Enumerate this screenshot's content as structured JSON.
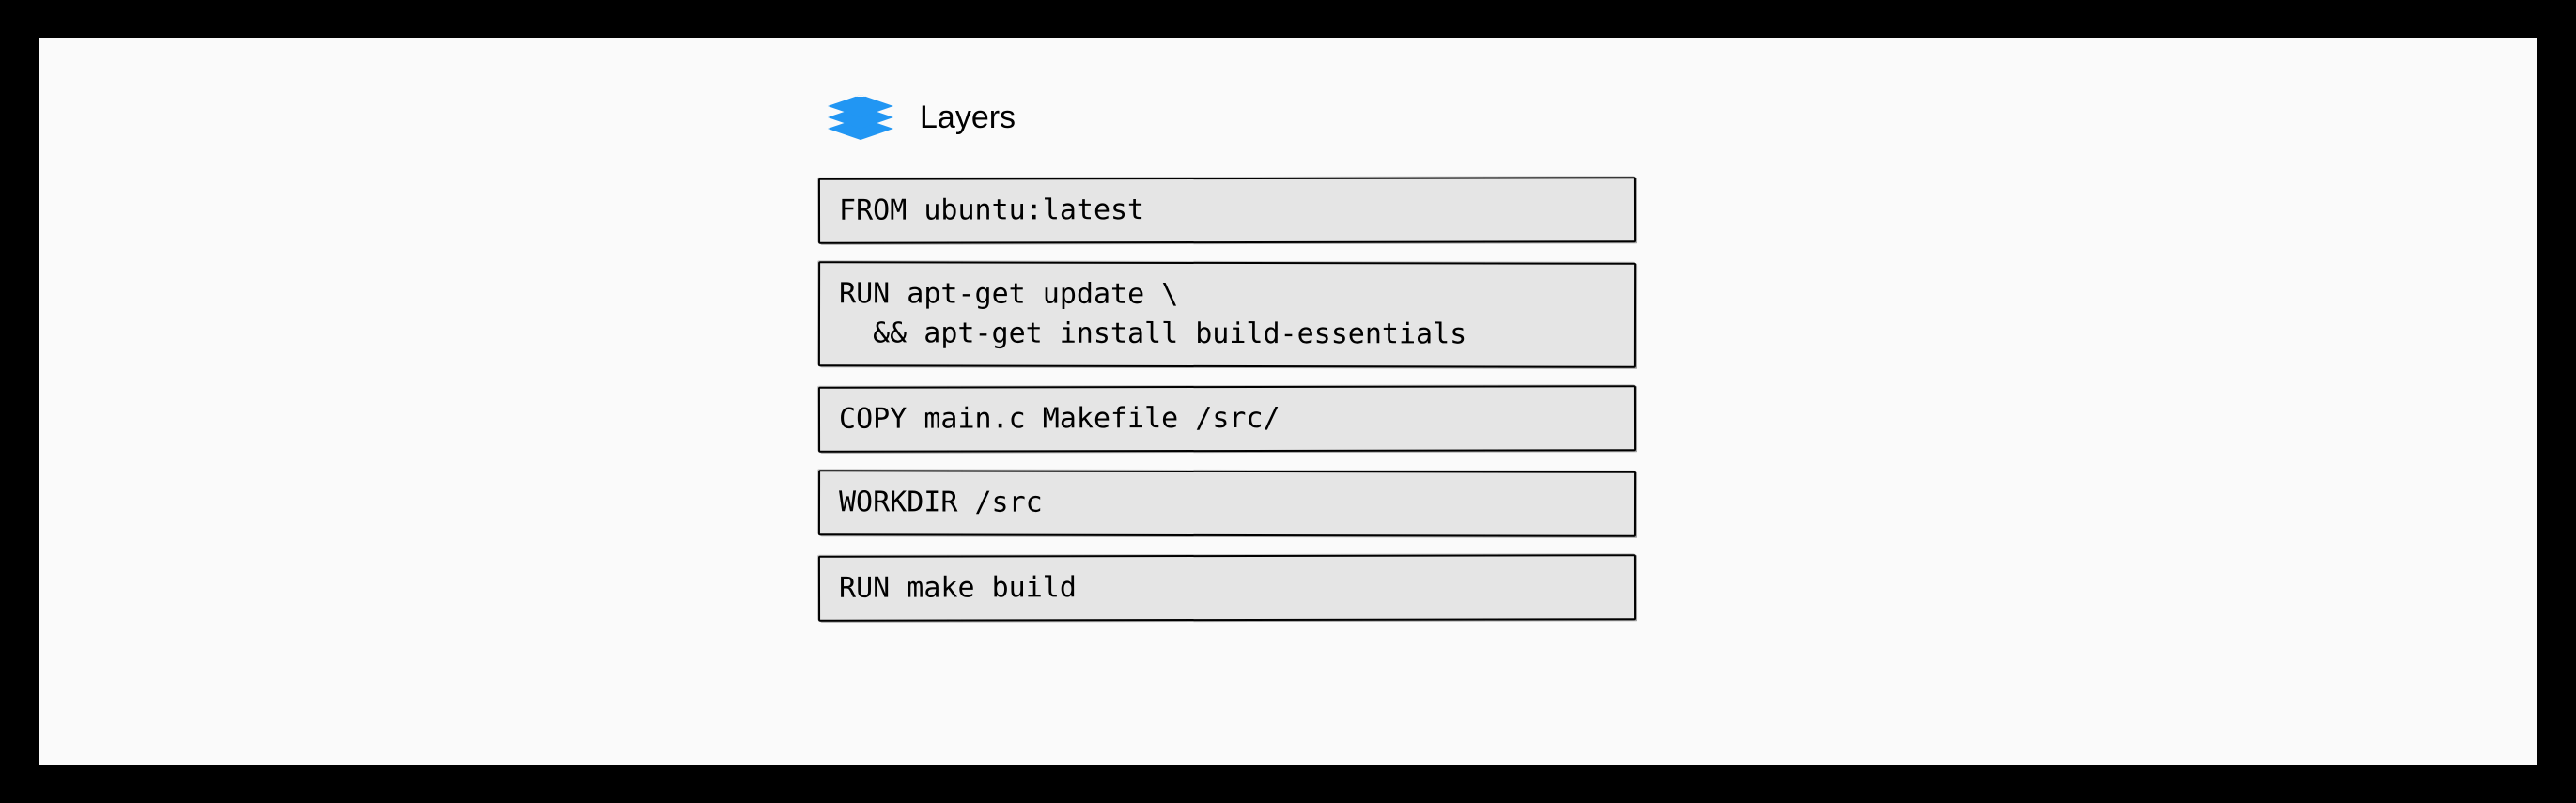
{
  "title": "Layers",
  "icon": "layers-icon",
  "instructions": [
    "FROM ubuntu:latest",
    "RUN apt-get update \\\n  && apt-get install build-essentials",
    "COPY main.c Makefile /src/",
    "WORKDIR /src",
    "RUN make build"
  ]
}
